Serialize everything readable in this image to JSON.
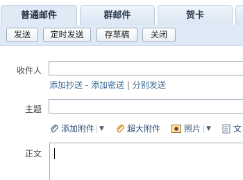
{
  "tabs": [
    {
      "label": "普通邮件"
    },
    {
      "label": "群邮件"
    },
    {
      "label": "贺卡"
    }
  ],
  "toolbar": {
    "send_label": "发送",
    "scheduled_send_label": "定时发送",
    "save_draft_label": "存草稿",
    "close_label": "关闭"
  },
  "form": {
    "recipient_label": "收件人",
    "recipient_value": "",
    "links": {
      "add_cc": "添加抄送",
      "dash": "-",
      "add_bcc": "添加密送",
      "pipe": "|",
      "separate_send": "分别发送"
    },
    "subject_label": "主题",
    "subject_value": "",
    "attachments": {
      "add_attachment": "添加附件",
      "large_attachment": "超大附件",
      "photo": "照片",
      "document_partial": "文"
    },
    "body_label": "正文"
  },
  "icons": {
    "tab_overflow": "tab-fragment",
    "attach": "paperclip-icon",
    "large_attach": "paperclip-orange-icon",
    "photo": "photo-icon",
    "document": "document-icon"
  }
}
